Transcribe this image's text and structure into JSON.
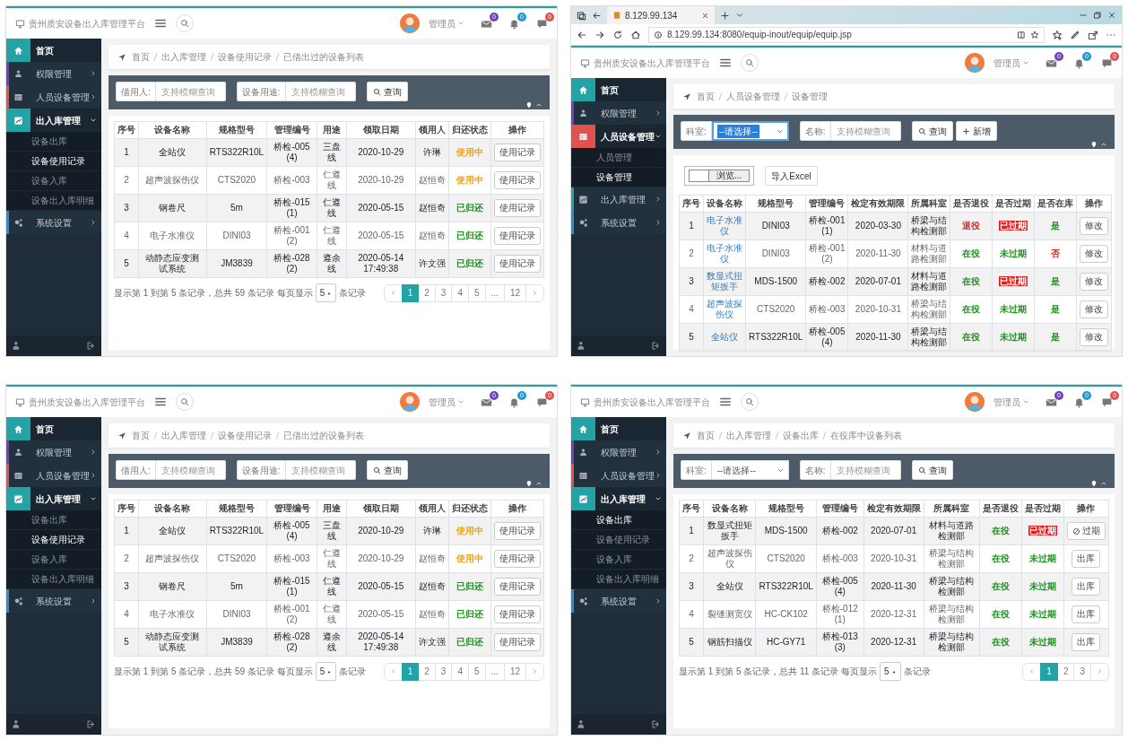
{
  "panels": [
    {
      "header": {
        "title": "贵州质安设备出入库管理平台",
        "user": "管理员",
        "badges": [
          {
            "count": "0",
            "color": "#6f42c1"
          },
          {
            "count": "0",
            "color": "#1c9ad6"
          },
          {
            "count": "0",
            "color": "#e0524d"
          }
        ]
      },
      "sidebar": {
        "items": [
          {
            "label": "首页",
            "color": "#23a3a6",
            "active": true,
            "expandable": false,
            "expanded": false
          },
          {
            "label": "权限管理",
            "color": "#6f42c1",
            "active": false,
            "expandable": true,
            "expanded": false
          },
          {
            "label": "人员设备管理",
            "color": "#e0524d",
            "active": false,
            "expandable": true,
            "expanded": false
          },
          {
            "label": "出入库管理",
            "color": "#23a3a6",
            "active": true,
            "expandable": true,
            "expanded": true,
            "children": [
              {
                "label": "设备出库",
                "selected": false
              },
              {
                "label": "设备使用记录",
                "selected": true
              },
              {
                "label": "设备入库",
                "selected": false
              },
              {
                "label": "设备出入库明细",
                "selected": false
              }
            ]
          },
          {
            "label": "系统设置",
            "color": "#2f8bd6",
            "active": false,
            "expandable": true,
            "expanded": false
          }
        ]
      },
      "breadcrumb": [
        "首页",
        "出入库管理",
        "设备使用记录",
        "已借出过的设备列表"
      ],
      "filters": [
        {
          "kind": "input",
          "label": "借用人:",
          "placeholder": "支持模糊查询"
        },
        {
          "kind": "input",
          "label": "设备用途:",
          "placeholder": "支持模糊查询"
        },
        {
          "kind": "search",
          "label": "查询"
        }
      ],
      "table": {
        "columns": [
          "序号",
          "设备名称",
          "规格型号",
          "管理编号",
          "用途",
          "领取日期",
          "领用人",
          "归还状态",
          "操作"
        ],
        "rows": [
          {
            "cells": [
              {
                "kind": "text",
                "text": "1"
              },
              {
                "kind": "text",
                "text": "全站仪"
              },
              {
                "kind": "text",
                "text": "RTS322R10L"
              },
              {
                "kind": "text",
                "text": "桥检-005 (4)"
              },
              {
                "kind": "text",
                "text": "三盘线"
              },
              {
                "kind": "text",
                "text": "2020-10-29"
              },
              {
                "kind": "text",
                "text": "许琳"
              },
              {
                "kind": "status",
                "text": "使用中",
                "color": "#f0a30a",
                "filled": false
              },
              {
                "kind": "button",
                "text": "使用记录",
                "disabled": false
              }
            ]
          },
          {
            "cells": [
              {
                "kind": "text",
                "text": "2"
              },
              {
                "kind": "text",
                "text": "超声波探伤仪"
              },
              {
                "kind": "text",
                "text": "CTS2020"
              },
              {
                "kind": "text",
                "text": "桥检-003"
              },
              {
                "kind": "text",
                "text": "仁遵线"
              },
              {
                "kind": "text",
                "text": "2020-10-29"
              },
              {
                "kind": "text",
                "text": "赵恒奇"
              },
              {
                "kind": "status",
                "text": "使用中",
                "color": "#f0a30a",
                "filled": false
              },
              {
                "kind": "button",
                "text": "使用记录",
                "disabled": false
              }
            ]
          },
          {
            "cells": [
              {
                "kind": "text",
                "text": "3"
              },
              {
                "kind": "text",
                "text": "钢卷尺"
              },
              {
                "kind": "text",
                "text": "5m"
              },
              {
                "kind": "text",
                "text": "桥检-015 (1)"
              },
              {
                "kind": "text",
                "text": "仁遵线"
              },
              {
                "kind": "text",
                "text": "2020-05-15"
              },
              {
                "kind": "text",
                "text": "赵恒奇"
              },
              {
                "kind": "status",
                "text": "已归还",
                "color": "#1c8f1c",
                "filled": false
              },
              {
                "kind": "button",
                "text": "使用记录",
                "disabled": false
              }
            ]
          },
          {
            "cells": [
              {
                "kind": "text",
                "text": "4"
              },
              {
                "kind": "text",
                "text": "电子水准仪"
              },
              {
                "kind": "text",
                "text": "DINI03"
              },
              {
                "kind": "text",
                "text": "桥检-001 (2)"
              },
              {
                "kind": "text",
                "text": "仁遵线"
              },
              {
                "kind": "text",
                "text": "2020-05-15"
              },
              {
                "kind": "text",
                "text": "赵恒奇"
              },
              {
                "kind": "status",
                "text": "已归还",
                "color": "#1c8f1c",
                "filled": false
              },
              {
                "kind": "button",
                "text": "使用记录",
                "disabled": false
              }
            ]
          },
          {
            "cells": [
              {
                "kind": "text",
                "text": "5"
              },
              {
                "kind": "text",
                "text": "动静态应变测试系统"
              },
              {
                "kind": "text",
                "text": "JM3839"
              },
              {
                "kind": "text",
                "text": "桥检-028 (2)"
              },
              {
                "kind": "text",
                "text": "遵余线"
              },
              {
                "kind": "text",
                "text": "2020-05-14 17:49:38"
              },
              {
                "kind": "text",
                "text": "许文强"
              },
              {
                "kind": "status",
                "text": "已归还",
                "color": "#1c8f1c",
                "filled": false
              },
              {
                "kind": "button",
                "text": "使用记录",
                "disabled": false
              }
            ]
          }
        ]
      },
      "footer": {
        "summary": "显示第 1 到第 5 条记录，总共 59 条记录 每页显示",
        "page_size": "5",
        "suffix": "条记录",
        "pages": [
          {
            "label": "1",
            "selected": true
          },
          {
            "label": "2",
            "selected": false
          },
          {
            "label": "3",
            "selected": false
          },
          {
            "label": "4",
            "selected": false
          },
          {
            "label": "5",
            "selected": false
          },
          {
            "label": "...",
            "selected": false
          },
          {
            "label": "12",
            "selected": false
          }
        ]
      }
    },
    {
      "browser": {
        "tab_title": "8.129.99.134",
        "url": "8.129.99.134:8080/equip-inout/equip/equip.jsp"
      },
      "header": {
        "title": "贵州质安设备出入库管理平台",
        "user": "管理员",
        "badges": [
          {
            "count": "0",
            "color": "#6f42c1"
          },
          {
            "count": "0",
            "color": "#1c9ad6"
          },
          {
            "count": "0",
            "color": "#e0524d"
          }
        ]
      },
      "sidebar": {
        "items": [
          {
            "label": "首页",
            "color": "#23a3a6",
            "active": true,
            "expandable": false,
            "expanded": false
          },
          {
            "label": "权限管理",
            "color": "#6f42c1",
            "active": false,
            "expandable": true,
            "expanded": false
          },
          {
            "label": "人员设备管理",
            "color": "#e0524d",
            "active": true,
            "expandable": true,
            "expanded": true,
            "children": [
              {
                "label": "人员管理",
                "selected": false
              },
              {
                "label": "设备管理",
                "selected": true
              }
            ]
          },
          {
            "label": "出入库管理",
            "color": "#23a3a6",
            "active": false,
            "expandable": true,
            "expanded": false
          },
          {
            "label": "系统设置",
            "color": "#2f8bd6",
            "active": false,
            "expandable": true,
            "expanded": false
          }
        ]
      },
      "breadcrumb": [
        "首页",
        "人员设备管理",
        "设备管理"
      ],
      "filters": [
        {
          "kind": "select",
          "label": "科室:",
          "value": "--请选择--",
          "focused": true
        },
        {
          "kind": "input",
          "label": "名称:",
          "placeholder": "支持模糊查询"
        },
        {
          "kind": "search",
          "label": "查询"
        },
        {
          "kind": "add",
          "label": "新增"
        }
      ],
      "tools": [
        {
          "kind": "file",
          "label": "浏览..."
        },
        {
          "kind": "button",
          "label": "导入Excel"
        }
      ],
      "table": {
        "columns": [
          "序号",
          "设备名称",
          "规格型号",
          "管理编号",
          "检定有效期限",
          "所属科室",
          "是否退役",
          "是否过期",
          "是否在库",
          "操作"
        ],
        "rows": [
          {
            "cells": [
              {
                "kind": "text",
                "text": "1"
              },
              {
                "kind": "link",
                "text": "电子水准仪"
              },
              {
                "kind": "text",
                "text": "DINI03"
              },
              {
                "kind": "text",
                "text": "桥检-001 (1)"
              },
              {
                "kind": "text",
                "text": "2020-03-30"
              },
              {
                "kind": "text",
                "text": "桥梁与结构检测部"
              },
              {
                "kind": "status",
                "text": "退役",
                "color": "#e02020",
                "filled": false
              },
              {
                "kind": "status",
                "text": "已过期",
                "color": "#e02020",
                "filled": true
              },
              {
                "kind": "status",
                "text": "是",
                "color": "#1c8f1c",
                "filled": false
              },
              {
                "kind": "button",
                "text": "修改",
                "disabled": false
              }
            ]
          },
          {
            "cells": [
              {
                "kind": "text",
                "text": "2"
              },
              {
                "kind": "link",
                "text": "电子水准仪"
              },
              {
                "kind": "text",
                "text": "DINI03"
              },
              {
                "kind": "text",
                "text": "桥检-001 (2)"
              },
              {
                "kind": "text",
                "text": "2020-11-30"
              },
              {
                "kind": "text",
                "text": "材料与道路检测部"
              },
              {
                "kind": "status",
                "text": "在役",
                "color": "#1c8f1c",
                "filled": false
              },
              {
                "kind": "status",
                "text": "未过期",
                "color": "#1c8f1c",
                "filled": false
              },
              {
                "kind": "status",
                "text": "否",
                "color": "#e02020",
                "filled": false
              },
              {
                "kind": "button",
                "text": "修改",
                "disabled": false
              }
            ]
          },
          {
            "cells": [
              {
                "kind": "text",
                "text": "3"
              },
              {
                "kind": "link",
                "text": "数显式扭矩扳手"
              },
              {
                "kind": "text",
                "text": "MDS-1500"
              },
              {
                "kind": "text",
                "text": "桥检-002"
              },
              {
                "kind": "text",
                "text": "2020-07-01"
              },
              {
                "kind": "text",
                "text": "材料与道路检测部"
              },
              {
                "kind": "status",
                "text": "在役",
                "color": "#1c8f1c",
                "filled": false
              },
              {
                "kind": "status",
                "text": "已过期",
                "color": "#e02020",
                "filled": true
              },
              {
                "kind": "status",
                "text": "是",
                "color": "#1c8f1c",
                "filled": false
              },
              {
                "kind": "button",
                "text": "修改",
                "disabled": false
              }
            ]
          },
          {
            "cells": [
              {
                "kind": "text",
                "text": "4"
              },
              {
                "kind": "link",
                "text": "超声波探伤仪"
              },
              {
                "kind": "text",
                "text": "CTS2020"
              },
              {
                "kind": "text",
                "text": "桥检-003"
              },
              {
                "kind": "text",
                "text": "2020-10-31"
              },
              {
                "kind": "text",
                "text": "桥梁与结构检测部"
              },
              {
                "kind": "status",
                "text": "在役",
                "color": "#1c8f1c",
                "filled": false
              },
              {
                "kind": "status",
                "text": "未过期",
                "color": "#1c8f1c",
                "filled": false
              },
              {
                "kind": "status",
                "text": "是",
                "color": "#1c8f1c",
                "filled": false
              },
              {
                "kind": "button",
                "text": "修改",
                "disabled": false
              }
            ]
          },
          {
            "cells": [
              {
                "kind": "text",
                "text": "5"
              },
              {
                "kind": "link",
                "text": "全站仪"
              },
              {
                "kind": "text",
                "text": "RTS322R10L"
              },
              {
                "kind": "text",
                "text": "桥检-005 (4)"
              },
              {
                "kind": "text",
                "text": "2020-11-30"
              },
              {
                "kind": "text",
                "text": "桥梁与结构检测部"
              },
              {
                "kind": "status",
                "text": "在役",
                "color": "#1c8f1c",
                "filled": false
              },
              {
                "kind": "status",
                "text": "未过期",
                "color": "#1c8f1c",
                "filled": false
              },
              {
                "kind": "status",
                "text": "是",
                "color": "#1c8f1c",
                "filled": false
              },
              {
                "kind": "button",
                "text": "修改",
                "disabled": false
              }
            ]
          }
        ]
      }
    },
    {
      "header": {
        "title": "贵州质安设备出入库管理平台",
        "user": "管理员",
        "badges": [
          {
            "count": "0",
            "color": "#6f42c1"
          },
          {
            "count": "0",
            "color": "#1c9ad6"
          },
          {
            "count": "0",
            "color": "#e0524d"
          }
        ]
      },
      "sidebar": {
        "items": [
          {
            "label": "首页",
            "color": "#23a3a6",
            "active": true,
            "expandable": false,
            "expanded": false
          },
          {
            "label": "权限管理",
            "color": "#6f42c1",
            "active": false,
            "expandable": true,
            "expanded": false
          },
          {
            "label": "人员设备管理",
            "color": "#e0524d",
            "active": false,
            "expandable": true,
            "expanded": false
          },
          {
            "label": "出入库管理",
            "color": "#23a3a6",
            "active": true,
            "expandable": true,
            "expanded": true,
            "children": [
              {
                "label": "设备出库",
                "selected": false
              },
              {
                "label": "设备使用记录",
                "selected": true
              },
              {
                "label": "设备入库",
                "selected": false
              },
              {
                "label": "设备出入库明细",
                "selected": false
              }
            ]
          },
          {
            "label": "系统设置",
            "color": "#2f8bd6",
            "active": false,
            "expandable": true,
            "expanded": false
          }
        ]
      },
      "breadcrumb": [
        "首页",
        "出入库管理",
        "设备使用记录",
        "已借出过的设备列表"
      ],
      "filters": [
        {
          "kind": "input",
          "label": "借用人:",
          "placeholder": "支持模糊查询"
        },
        {
          "kind": "input",
          "label": "设备用途:",
          "placeholder": "支持模糊查询"
        },
        {
          "kind": "search",
          "label": "查询"
        }
      ],
      "table": {
        "columns": [
          "序号",
          "设备名称",
          "规格型号",
          "管理编号",
          "用途",
          "领取日期",
          "领用人",
          "归还状态",
          "操作"
        ],
        "rows": [
          {
            "cells": [
              {
                "kind": "text",
                "text": "1"
              },
              {
                "kind": "text",
                "text": "全站仪"
              },
              {
                "kind": "text",
                "text": "RTS322R10L"
              },
              {
                "kind": "text",
                "text": "桥检-005 (4)"
              },
              {
                "kind": "text",
                "text": "三盘线"
              },
              {
                "kind": "text",
                "text": "2020-10-29"
              },
              {
                "kind": "text",
                "text": "许琳"
              },
              {
                "kind": "status",
                "text": "使用中",
                "color": "#f0a30a",
                "filled": false
              },
              {
                "kind": "button",
                "text": "使用记录",
                "disabled": false
              }
            ]
          },
          {
            "cells": [
              {
                "kind": "text",
                "text": "2"
              },
              {
                "kind": "text",
                "text": "超声波探伤仪"
              },
              {
                "kind": "text",
                "text": "CTS2020"
              },
              {
                "kind": "text",
                "text": "桥检-003"
              },
              {
                "kind": "text",
                "text": "仁遵线"
              },
              {
                "kind": "text",
                "text": "2020-10-29"
              },
              {
                "kind": "text",
                "text": "赵恒奇"
              },
              {
                "kind": "status",
                "text": "使用中",
                "color": "#f0a30a",
                "filled": false
              },
              {
                "kind": "button",
                "text": "使用记录",
                "disabled": false
              }
            ]
          },
          {
            "cells": [
              {
                "kind": "text",
                "text": "3"
              },
              {
                "kind": "text",
                "text": "钢卷尺"
              },
              {
                "kind": "text",
                "text": "5m"
              },
              {
                "kind": "text",
                "text": "桥检-015 (1)"
              },
              {
                "kind": "text",
                "text": "仁遵线"
              },
              {
                "kind": "text",
                "text": "2020-05-15"
              },
              {
                "kind": "text",
                "text": "赵恒奇"
              },
              {
                "kind": "status",
                "text": "已归还",
                "color": "#1c8f1c",
                "filled": false
              },
              {
                "kind": "button",
                "text": "使用记录",
                "disabled": false
              }
            ]
          },
          {
            "cells": [
              {
                "kind": "text",
                "text": "4"
              },
              {
                "kind": "text",
                "text": "电子水准仪"
              },
              {
                "kind": "text",
                "text": "DINI03"
              },
              {
                "kind": "text",
                "text": "桥检-001 (2)"
              },
              {
                "kind": "text",
                "text": "仁遵线"
              },
              {
                "kind": "text",
                "text": "2020-05-15"
              },
              {
                "kind": "text",
                "text": "赵恒奇"
              },
              {
                "kind": "status",
                "text": "已归还",
                "color": "#1c8f1c",
                "filled": false
              },
              {
                "kind": "button",
                "text": "使用记录",
                "disabled": false
              }
            ]
          },
          {
            "cells": [
              {
                "kind": "text",
                "text": "5"
              },
              {
                "kind": "text",
                "text": "动静态应变测试系统"
              },
              {
                "kind": "text",
                "text": "JM3839"
              },
              {
                "kind": "text",
                "text": "桥检-028 (2)"
              },
              {
                "kind": "text",
                "text": "遵余线"
              },
              {
                "kind": "text",
                "text": "2020-05-14 17:49:38"
              },
              {
                "kind": "text",
                "text": "许文强"
              },
              {
                "kind": "status",
                "text": "已归还",
                "color": "#1c8f1c",
                "filled": false
              },
              {
                "kind": "button",
                "text": "使用记录",
                "disabled": false
              }
            ]
          }
        ]
      },
      "footer": {
        "summary": "显示第 1 到第 5 条记录，总共 59 条记录 每页显示",
        "page_size": "5",
        "suffix": "条记录",
        "pages": [
          {
            "label": "1",
            "selected": true
          },
          {
            "label": "2",
            "selected": false
          },
          {
            "label": "3",
            "selected": false
          },
          {
            "label": "4",
            "selected": false
          },
          {
            "label": "5",
            "selected": false
          },
          {
            "label": "...",
            "selected": false
          },
          {
            "label": "12",
            "selected": false
          }
        ]
      }
    },
    {
      "header": {
        "title": "贵州质安设备出入库管理平台",
        "user": "管理员",
        "badges": [
          {
            "count": "0",
            "color": "#6f42c1"
          },
          {
            "count": "0",
            "color": "#1c9ad6"
          },
          {
            "count": "0",
            "color": "#e0524d"
          }
        ]
      },
      "sidebar": {
        "items": [
          {
            "label": "首页",
            "color": "#23a3a6",
            "active": true,
            "expandable": false,
            "expanded": false
          },
          {
            "label": "权限管理",
            "color": "#6f42c1",
            "active": false,
            "expandable": true,
            "expanded": false
          },
          {
            "label": "人员设备管理",
            "color": "#e0524d",
            "active": false,
            "expandable": true,
            "expanded": false
          },
          {
            "label": "出入库管理",
            "color": "#23a3a6",
            "active": true,
            "expandable": true,
            "expanded": true,
            "children": [
              {
                "label": "设备出库",
                "selected": true
              },
              {
                "label": "设备使用记录",
                "selected": false
              },
              {
                "label": "设备入库",
                "selected": false
              },
              {
                "label": "设备出入库明细",
                "selected": false
              }
            ]
          },
          {
            "label": "系统设置",
            "color": "#2f8bd6",
            "active": false,
            "expandable": true,
            "expanded": false
          }
        ]
      },
      "breadcrumb": [
        "首页",
        "出入库管理",
        "设备出库",
        "在役库中设备列表"
      ],
      "filters": [
        {
          "kind": "select",
          "label": "科室:",
          "value": "--请选择--",
          "focused": false
        },
        {
          "kind": "input",
          "label": "名称:",
          "placeholder": "支持模糊查询"
        },
        {
          "kind": "search",
          "label": "查询"
        }
      ],
      "table": {
        "columns": [
          "序号",
          "设备名称",
          "规格型号",
          "管理编号",
          "检定有效期限",
          "所属科室",
          "是否退役",
          "是否过期",
          "操作"
        ],
        "rows": [
          {
            "cells": [
              {
                "kind": "text",
                "text": "1"
              },
              {
                "kind": "text",
                "text": "数显式扭矩扳手"
              },
              {
                "kind": "text",
                "text": "MDS-1500"
              },
              {
                "kind": "text",
                "text": "桥检-002"
              },
              {
                "kind": "text",
                "text": "2020-07-01"
              },
              {
                "kind": "text",
                "text": "材料与道路检测部"
              },
              {
                "kind": "status",
                "text": "在役",
                "color": "#1c8f1c",
                "filled": false
              },
              {
                "kind": "status",
                "text": "已过期",
                "color": "#e02020",
                "filled": true
              },
              {
                "kind": "button",
                "text": "过期",
                "disabled": true
              }
            ]
          },
          {
            "cells": [
              {
                "kind": "text",
                "text": "2"
              },
              {
                "kind": "text",
                "text": "超声波探伤仪"
              },
              {
                "kind": "text",
                "text": "CTS2020"
              },
              {
                "kind": "text",
                "text": "桥检-003"
              },
              {
                "kind": "text",
                "text": "2020-10-31"
              },
              {
                "kind": "text",
                "text": "桥梁与结构检测部"
              },
              {
                "kind": "status",
                "text": "在役",
                "color": "#1c8f1c",
                "filled": false
              },
              {
                "kind": "status",
                "text": "未过期",
                "color": "#1c8f1c",
                "filled": false
              },
              {
                "kind": "button",
                "text": "出库",
                "disabled": false
              }
            ]
          },
          {
            "cells": [
              {
                "kind": "text",
                "text": "3"
              },
              {
                "kind": "text",
                "text": "全站仪"
              },
              {
                "kind": "text",
                "text": "RTS322R10L"
              },
              {
                "kind": "text",
                "text": "桥检-005 (4)"
              },
              {
                "kind": "text",
                "text": "2020-11-30"
              },
              {
                "kind": "text",
                "text": "桥梁与结构检测部"
              },
              {
                "kind": "status",
                "text": "在役",
                "color": "#1c8f1c",
                "filled": false
              },
              {
                "kind": "status",
                "text": "未过期",
                "color": "#1c8f1c",
                "filled": false
              },
              {
                "kind": "button",
                "text": "出库",
                "disabled": false
              }
            ]
          },
          {
            "cells": [
              {
                "kind": "text",
                "text": "4"
              },
              {
                "kind": "text",
                "text": "裂缝测宽仪"
              },
              {
                "kind": "text",
                "text": "HC-CK102"
              },
              {
                "kind": "text",
                "text": "桥检-012 (1)"
              },
              {
                "kind": "text",
                "text": "2020-12-31"
              },
              {
                "kind": "text",
                "text": "桥梁与结构检测部"
              },
              {
                "kind": "status",
                "text": "在役",
                "color": "#1c8f1c",
                "filled": false
              },
              {
                "kind": "status",
                "text": "未过期",
                "color": "#1c8f1c",
                "filled": false
              },
              {
                "kind": "button",
                "text": "出库",
                "disabled": false
              }
            ]
          },
          {
            "cells": [
              {
                "kind": "text",
                "text": "5"
              },
              {
                "kind": "text",
                "text": "钢筋扫描仪"
              },
              {
                "kind": "text",
                "text": "HC-GY71"
              },
              {
                "kind": "text",
                "text": "桥检-013 (3)"
              },
              {
                "kind": "text",
                "text": "2020-12-31"
              },
              {
                "kind": "text",
                "text": "桥梁与结构检测部"
              },
              {
                "kind": "status",
                "text": "在役",
                "color": "#1c8f1c",
                "filled": false
              },
              {
                "kind": "status",
                "text": "未过期",
                "color": "#1c8f1c",
                "filled": false
              },
              {
                "kind": "button",
                "text": "出库",
                "disabled": false
              }
            ]
          }
        ]
      },
      "footer": {
        "summary": "显示第 1 到第 5 条记录，总共 11 条记录 每页显示",
        "page_size": "5",
        "suffix": "条记录",
        "pages": [
          {
            "label": "1",
            "selected": true
          },
          {
            "label": "2",
            "selected": false
          },
          {
            "label": "3",
            "selected": false
          }
        ]
      }
    }
  ]
}
